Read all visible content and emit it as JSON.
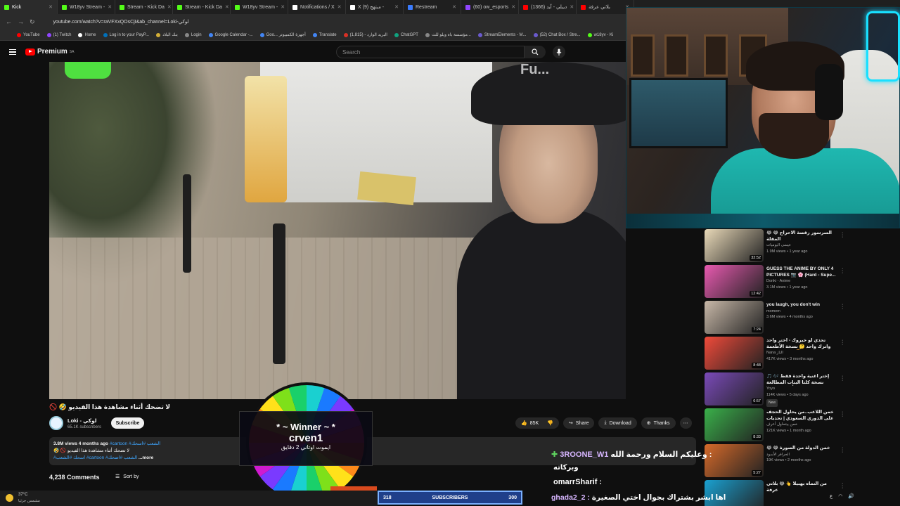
{
  "browser": {
    "tabs": [
      {
        "label": "Kick",
        "color": "#53fc18"
      },
      {
        "label": "W18yv Stream - ",
        "color": "#53fc18"
      },
      {
        "label": "Stream - Kick Da",
        "color": "#53fc18"
      },
      {
        "label": "Stream - Kick Da",
        "color": "#53fc18"
      },
      {
        "label": "W18yv Stream - ",
        "color": "#53fc18"
      },
      {
        "label": "Notifications / X",
        "color": "#ffffff"
      },
      {
        "label": "X (9) مبتهج -",
        "color": "#ffffff"
      },
      {
        "label": "Restream",
        "color": "#3a7bfd"
      },
      {
        "label": "(60) ow_esports",
        "color": "#9146ff"
      },
      {
        "label": "(1366) ديبلي - آيد",
        "color": "#ff0000"
      },
      {
        "label": "بلاتي عرفة",
        "color": "#ff0000"
      }
    ],
    "url": "youtube.com/watch?v=raVFXxQOsCjI&ab_channel=Loki-لوكي",
    "bookmarks": [
      "YouTube",
      "(1) Twitch",
      "Home",
      "Log in to your PayP...",
      "بنك البلاد",
      "Login",
      "Google Calendar -...",
      "Goo... أجهزة الكمبيوتر",
      "Translate",
      "البريد الوارد - (1,815)",
      "ChatGPT",
      "مؤسسة باه ويلو للت...",
      "StreamElements - M...",
      "(52) Chat Box / Stre...",
      "w18yv - Ki"
    ]
  },
  "youtube": {
    "logo": "Premium",
    "region": "SA",
    "search_placeholder": "Search",
    "video_overlay_text": "Fu...",
    "video_title": "🚫 🤣 لا تضحك أثناء مشاهدة هذا الفيديو",
    "channel_name": "Loki - لوكي",
    "channel_subs": "65.1K subscribers",
    "subscribe_label": "Subscribe",
    "likes": "85K",
    "share": "Share",
    "download": "Download",
    "thanks": "Thanks",
    "desc_views": "3.8M views  4 months ago",
    "desc_tags_top": "#cartoon #الشعب #اسحك",
    "desc_line2": "🤣 🚫 لا تضحك أثناء مشاهدة هذا الفيديو",
    "desc_tags": "#اسحك #الشعب #cartoon #الشعب #اضحك",
    "desc_more": "...more",
    "comments": "4,238 Comments",
    "sort_by": "Sort by"
  },
  "sidebar": [
    {
      "title": "😂 😂 السرسور رقصة الاحراج المقلة",
      "channel": "عيسى اليوميات",
      "meta": "1.9M views • 1 year ago",
      "duration": "32:52",
      "bg": "#e9d9b8"
    },
    {
      "title": "GUESS THE ANIME BY ONLY 4 PICTURES 📷 🌸 (Hard - Supe...",
      "channel": "Donki - Anime",
      "meta": "3.1M views • 1 year ago",
      "duration": "12:42",
      "bg": "#e85ab0"
    },
    {
      "title": "you laugh, you don't win",
      "channel": "momem",
      "meta": "3.6M views • 4 months ago",
      "duration": "7:24",
      "bg": "#c8b8a8"
    },
    {
      "title": "تحدي لو خيروك - اختر واحد واترك واحد 🤔 نسخة الأطعمة والمشروبات 🍔",
      "channel": "Nana الناز",
      "meta": "417K views • 3 months ago",
      "duration": "8:48",
      "bg": "#f04a3a"
    },
    {
      "title": "إختر أغنية واحدة فقط 🎶 🎵 نسخة كلتا البنات المطالعة sakura من البنات في أغنية شعبية",
      "channel": "Yoyo",
      "meta": "114K views • 5 days ago",
      "duration": "6:57",
      "badge": "New",
      "bg": "#7a4ab8"
    },
    {
      "title": "خمن اللاعب..من يحاول الحجف على الدوري السعودي | تحديات كرة قدم",
      "channel": "خمن بيتحاول أعرف",
      "meta": "121K views • 1 month ago",
      "duration": "8:33",
      "bg": "#3ab04a"
    },
    {
      "title": "😂 😂 خمن الدولة من الصورة",
      "channel": "الحرافر الأسود",
      "meta": "19K views • 2 months ago",
      "duration": "5:27",
      "bg": "#d66a2a"
    },
    {
      "title": "من النماه بهبيلا 👆 😂 بلاتي عرفة",
      "channel": "",
      "meta": "",
      "duration": "",
      "bg": "#1aa0d0"
    }
  ],
  "stream": {
    "winner_label": "* ~ Winner ~ *",
    "winner_name": "crven1",
    "winner_reward": "ايموت اوتاني 2 دقايق",
    "chat": [
      {
        "user": "3ROONE_W1",
        "text": "وعليكم السلام ورحمة الله :"
      },
      {
        "user": "",
        "text": "وبركاته"
      },
      {
        "user": "omarrSharif :",
        "text": ""
      },
      {
        "user": "ghada2_2 :",
        "text": "اها ابشر بشتراك بجوال اختي الصغيرة"
      }
    ],
    "subs_current": "318",
    "subs_label": "SUBSCRIBERS",
    "subs_goal": "300",
    "banner": "elseries"
  },
  "taskbar": {
    "temp": "37°C",
    "condition": "مشمس جزئيا",
    "lang": "ع"
  },
  "colors": {
    "yt_red": "#ff0000",
    "accent_neon": "#19e0ff",
    "kick_green": "#53fc18"
  }
}
